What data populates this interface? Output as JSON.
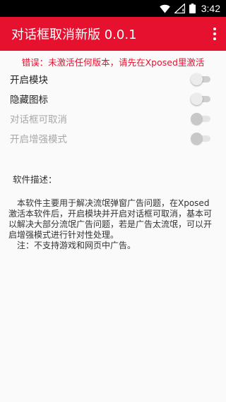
{
  "status_bar": {
    "time": "3:42",
    "icons": [
      "wifi-icon",
      "signal-icon",
      "battery-icon"
    ]
  },
  "app_bar": {
    "title": "对话框取消新版 0.0.1",
    "menu_icon": "more-vert-icon"
  },
  "error_message": "错误：未激活任何版本，请先在Xposed里激活",
  "settings": [
    {
      "label": "开启模块",
      "enabled": true,
      "checked": false
    },
    {
      "label": "隐藏图标",
      "enabled": true,
      "checked": false
    },
    {
      "label": "对话框可取消",
      "enabled": false,
      "checked": false
    },
    {
      "label": "开启增强模式",
      "enabled": false,
      "checked": false
    }
  ],
  "description": {
    "heading": "软件描述：",
    "paragraph1": "本软件主要用于解决流氓弹窗广告问题，在Xposed激活本软件后，开启模块并开启对话框可取消，基本可以解决大部分流氓广告问题，若是广告太流氓，可以开启增强模式进行针对性处理。",
    "paragraph2": "注：不支持游戏和网页中广告。"
  },
  "colors": {
    "primary": "#e5112f",
    "status_bar": "#000000",
    "background": "#fafafa"
  }
}
